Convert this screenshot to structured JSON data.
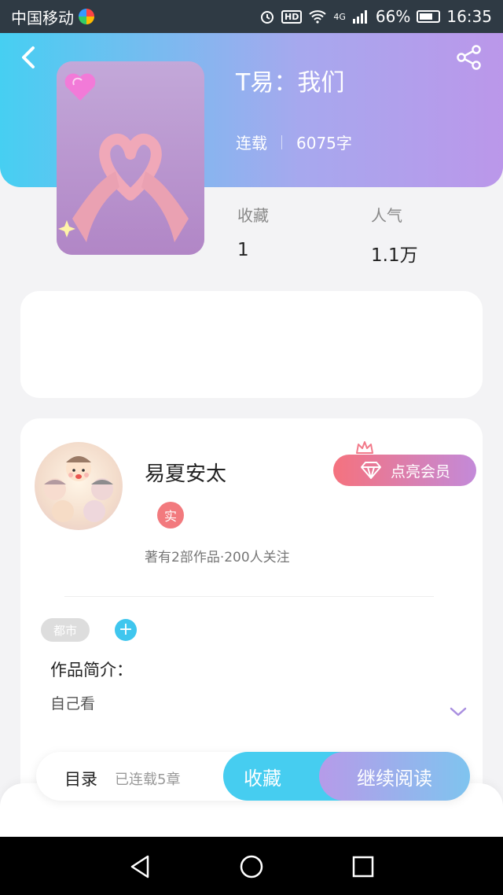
{
  "status_bar": {
    "carrier": "中国移动",
    "hd": "HD",
    "network": "4G",
    "battery": "66%",
    "time": "16:35"
  },
  "book": {
    "title": "T易：我们",
    "status": "连载",
    "word_count": "6075字",
    "favorites_label": "收藏",
    "favorites_value": "1",
    "popularity_label": "人气",
    "popularity_value": "1.1万"
  },
  "author": {
    "name": "易夏安太",
    "badge": "实",
    "stats": "著有2部作品·200人关注",
    "vip_label": "点亮会员"
  },
  "details": {
    "tag": "都市",
    "add_tag": "+",
    "intro_heading": "作品简介：",
    "intro_text": "自己看"
  },
  "actions": {
    "toc": "目录",
    "chapters": "已连载5章",
    "collect": "收藏",
    "continue": "继续阅读"
  },
  "colors": {
    "header_start": "#46cff2",
    "header_end": "#bb97ea",
    "accent_blue": "#46cdf0",
    "vip_start": "#f5727e",
    "vip_end": "#c38ad9"
  }
}
